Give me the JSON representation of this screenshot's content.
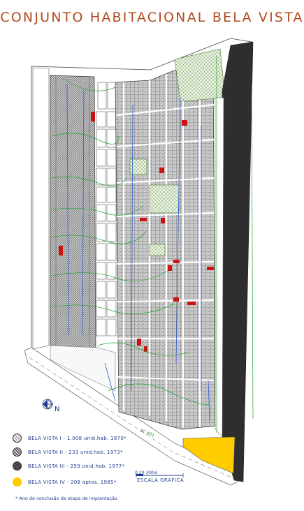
{
  "title": "CONJUNTO HABITACIONAL BELA VISTA",
  "legend": [
    {
      "label": "BELA VISTA I  -  1.008 unid.hab.  1970*",
      "phase": "I",
      "pattern": "light-hatch"
    },
    {
      "label": "BELA VISTA II  -  233 unid.hab.  1973*",
      "phase": "II",
      "pattern": "medium-hatch"
    },
    {
      "label": "BELA VISTA III  -  259 unid.hab.  1977*",
      "phase": "III",
      "pattern": "dark-hatch"
    },
    {
      "label": "BELA VISTA IV  -  208 aptos.  1985*",
      "phase": "IV",
      "pattern": "yellow"
    }
  ],
  "footnote": "* Ano de conclusão da etapa de implantação",
  "scale": {
    "label": "ESCALA GRÁFICA",
    "ticks": "0  20        100m"
  },
  "north": {
    "label": "N",
    "icon": "north-arrow-icon"
  },
  "road_label": "SC 401",
  "colors": {
    "title": "#b24a1f",
    "dark_zone": "#2e2e2e",
    "yellow_zone": "#ffcc00",
    "red_lot": "#cc1111",
    "green_line": "#1fa52b",
    "blue_line": "#2a5bd7"
  }
}
